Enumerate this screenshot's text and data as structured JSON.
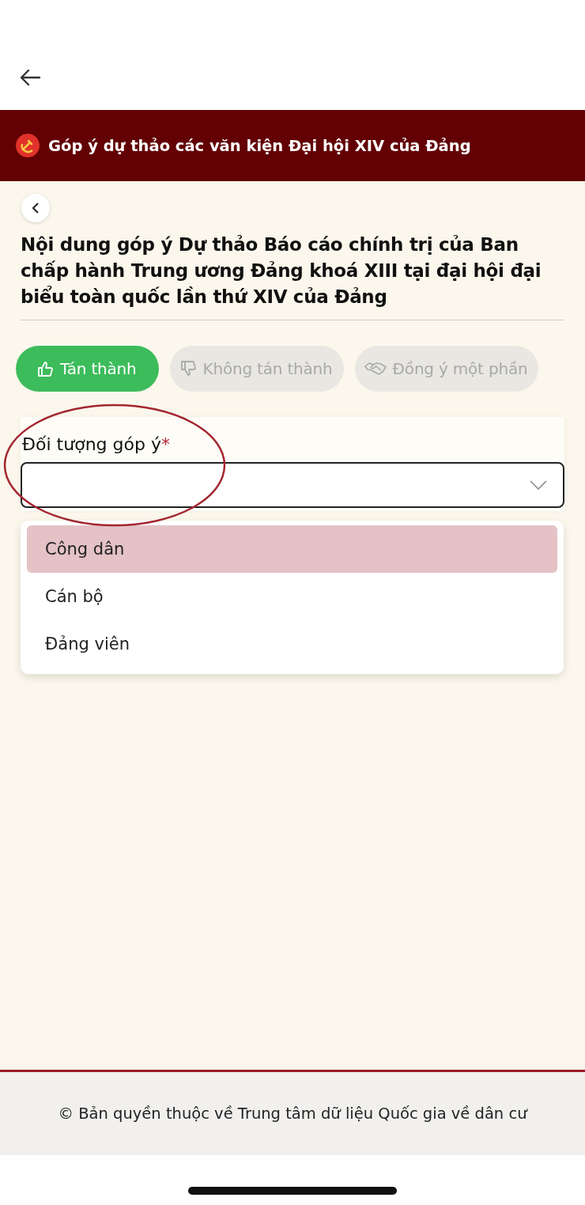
{
  "banner": {
    "title": "Góp ý dự thảo các văn kiện Đại hội XIV của Đảng"
  },
  "heading": "Nội dung góp ý Dự thảo Báo cáo chính trị của Ban chấp hành Trung ương Đảng khoá XIII tại đại hội đại biểu toàn quốc lần thứ XIV của Đảng",
  "opinions": [
    {
      "kind": "thumbs-up",
      "label": "Tán thành",
      "selected": true
    },
    {
      "kind": "thumbs-down",
      "label": "Không tán thành",
      "selected": false
    },
    {
      "kind": "handshake",
      "label": "Đồng ý một phần",
      "selected": false
    }
  ],
  "field": {
    "label": "Đối tượng góp ý",
    "required_mark": "*",
    "expanded": true
  },
  "options": [
    {
      "label": "Công dân",
      "selected": true
    },
    {
      "label": "Cán bộ",
      "selected": false
    },
    {
      "label": "Đảng viên",
      "selected": false
    }
  ],
  "annotations": [
    {
      "kind": "ellipse"
    }
  ],
  "footer": "© Bản quyền thuộc về Trung tâm dữ liệu Quốc gia về dân cư"
}
